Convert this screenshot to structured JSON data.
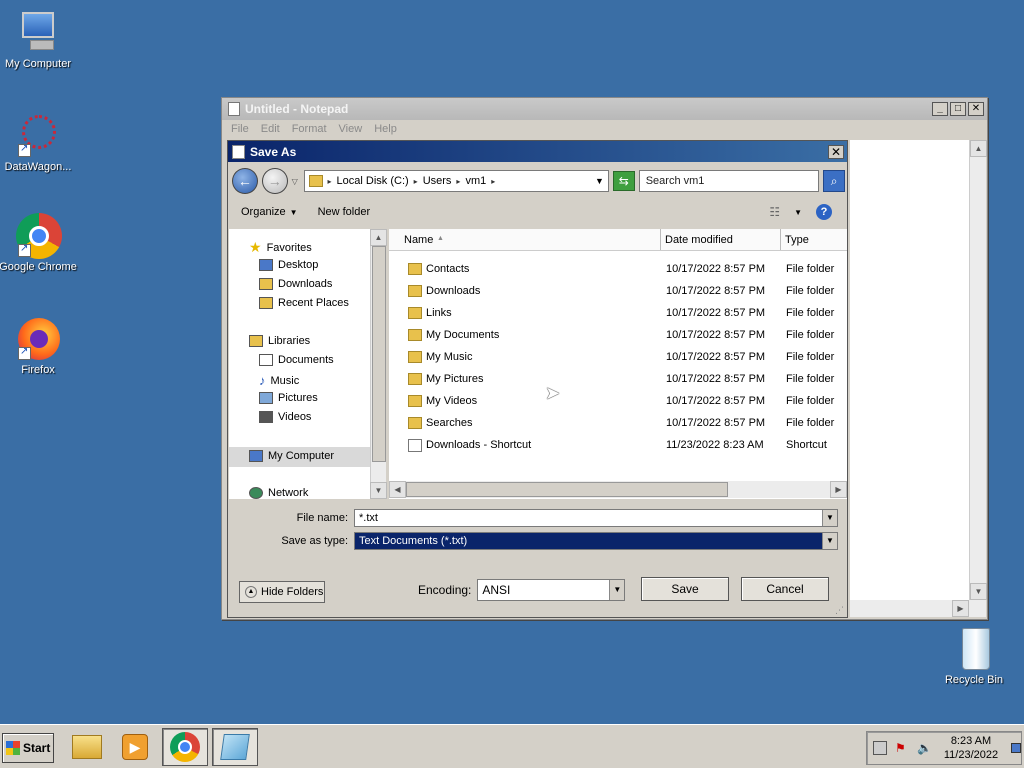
{
  "desktop": {
    "icons": [
      {
        "label": "My Computer"
      },
      {
        "label": "DataWagon..."
      },
      {
        "label": "Google Chrome"
      },
      {
        "label": "Firefox"
      },
      {
        "label": "Recycle Bin"
      }
    ]
  },
  "notepad": {
    "title": "Untitled - Notepad",
    "menu": [
      "File",
      "Edit",
      "Format",
      "View",
      "Help"
    ]
  },
  "dialog": {
    "title": "Save As",
    "breadcrumb": [
      "Local Disk (C:)",
      "Users",
      "vm1"
    ],
    "search_placeholder": "Search vm1",
    "toolbar": {
      "organize": "Organize",
      "new_folder": "New folder"
    },
    "nav": {
      "favorites": "Favorites",
      "favorites_items": [
        "Desktop",
        "Downloads",
        "Recent Places"
      ],
      "libraries": "Libraries",
      "libraries_items": [
        "Documents",
        "Music",
        "Pictures",
        "Videos"
      ],
      "computer": "My Computer",
      "network": "Network"
    },
    "columns": {
      "name": "Name",
      "date": "Date modified",
      "type": "Type"
    },
    "files": [
      {
        "name": "Contacts",
        "date": "10/17/2022 8:57 PM",
        "type": "File folder"
      },
      {
        "name": "Downloads",
        "date": "10/17/2022 8:57 PM",
        "type": "File folder"
      },
      {
        "name": "Links",
        "date": "10/17/2022 8:57 PM",
        "type": "File folder"
      },
      {
        "name": "My Documents",
        "date": "10/17/2022 8:57 PM",
        "type": "File folder"
      },
      {
        "name": "My Music",
        "date": "10/17/2022 8:57 PM",
        "type": "File folder"
      },
      {
        "name": "My Pictures",
        "date": "10/17/2022 8:57 PM",
        "type": "File folder"
      },
      {
        "name": "My Videos",
        "date": "10/17/2022 8:57 PM",
        "type": "File folder"
      },
      {
        "name": "Searches",
        "date": "10/17/2022 8:57 PM",
        "type": "File folder"
      },
      {
        "name": "Downloads - Shortcut",
        "date": "11/23/2022 8:23 AM",
        "type": "Shortcut"
      }
    ],
    "file_name_label": "File name:",
    "file_name_value": "*.txt",
    "save_type_label": "Save as type:",
    "save_type_value": "Text Documents (*.txt)",
    "hide_folders": "Hide Folders",
    "encoding_label": "Encoding:",
    "encoding_value": "ANSI",
    "save": "Save",
    "cancel": "Cancel"
  },
  "taskbar": {
    "start": "Start",
    "time": "8:23 AM",
    "date": "11/23/2022"
  }
}
